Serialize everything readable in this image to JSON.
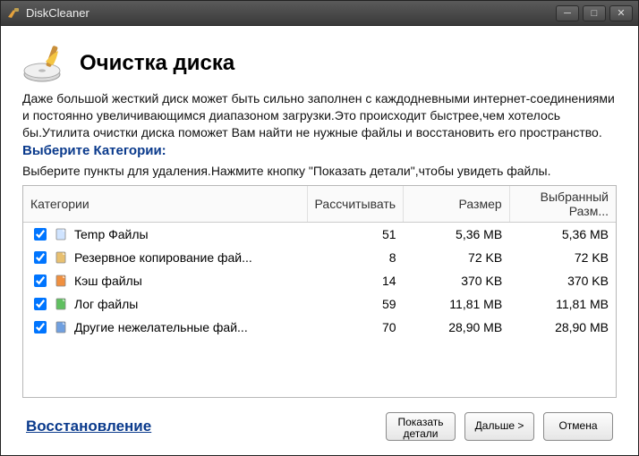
{
  "titlebar": {
    "title": "DiskCleaner"
  },
  "header": {
    "title": "Очистка диска",
    "description": "Даже большой жесткий диск может быть сильно заполнен с каждодневными интернет-соединениями и постоянно увеличивающимся диапазоном загрузки.Это происходит быстрее,чем хотелось бы.Утилита очистки диска поможет Вам найти не нужные файлы и восстановить его пространство."
  },
  "section": {
    "label": "Выберите Категории:",
    "hint": "Выберите пункты для удаления.Нажмите кнопку \"Показать детали\",чтобы увидеть файлы."
  },
  "table": {
    "headers": {
      "category": "Категории",
      "count": "Рассчитывать",
      "size": "Размер",
      "selected_size": "Выбранный Разм..."
    },
    "rows": [
      {
        "checked": true,
        "icon": "file-icon",
        "name": "Temp Файлы",
        "count": "51",
        "size": "5,36 MB",
        "selected": "5,36 MB"
      },
      {
        "checked": true,
        "icon": "backup-icon",
        "name": "Резервное копирование фай...",
        "count": "8",
        "size": "72 KB",
        "selected": "72 KB"
      },
      {
        "checked": true,
        "icon": "cache-icon",
        "name": "Кэш файлы",
        "count": "14",
        "size": "370 KB",
        "selected": "370 KB"
      },
      {
        "checked": true,
        "icon": "log-icon",
        "name": "Лог файлы",
        "count": "59",
        "size": "11,81 MB",
        "selected": "11,81 MB"
      },
      {
        "checked": true,
        "icon": "junk-icon",
        "name": "Другие нежелательные фай...",
        "count": "70",
        "size": "28,90 MB",
        "selected": "28,90 MB"
      }
    ]
  },
  "footer": {
    "restore_link": "Восстановление",
    "show_details": "Показать\nдетали",
    "next": "Дальше >",
    "cancel": "Отмена"
  },
  "icons": {
    "file-icon": "#d0e4ff",
    "backup-icon": "#e8c070",
    "cache-icon": "#f09040",
    "log-icon": "#60c060",
    "junk-icon": "#70a0e0"
  }
}
